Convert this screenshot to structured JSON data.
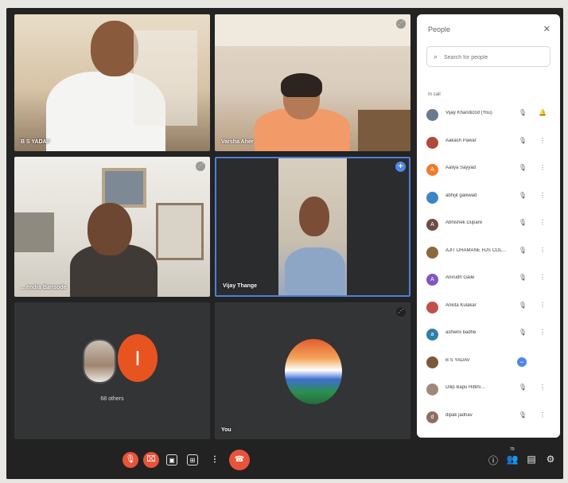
{
  "tiles": {
    "t1": {
      "name": "B S YADAV"
    },
    "t2": {
      "name": "Varsha Aher"
    },
    "t3": {
      "name": "…endra Bansode"
    },
    "t4": {
      "name": "Vijay Thange"
    },
    "t5": {
      "avatar_letter": "I",
      "others": "68 others"
    },
    "t6": {
      "name": "You"
    }
  },
  "panel": {
    "title": "People",
    "close": "✕",
    "search_placeholder": "Search for people",
    "section": "In call",
    "people": [
      {
        "name": "Vijay Khandizod (You)",
        "avatar": "",
        "color": "#6b7a8c",
        "mic": "🎙",
        "more": "🔔"
      },
      {
        "name": "Aakash Pawar",
        "avatar": "",
        "color": "#b04a3a",
        "mic": "🎙",
        "more": "⋮"
      },
      {
        "name": "Aaliya Sayyad",
        "avatar": "A",
        "color": "#f07b2d",
        "mic": "🎙",
        "more": "⋮"
      },
      {
        "name": "abhijit gaikwad",
        "avatar": "",
        "color": "#3d86c6",
        "mic": "🎙",
        "more": "⋮"
      },
      {
        "name": "Abhishek Dupare",
        "avatar": "A",
        "color": "#6d4c41",
        "mic": "🎙",
        "more": "⋮"
      },
      {
        "name": "AJIT DHAMANE HJS COL…",
        "avatar": "",
        "color": "#8a6a3a",
        "mic": "🎙",
        "more": "⋮"
      },
      {
        "name": "Anirudh Gaile",
        "avatar": "A",
        "color": "#7e57c2",
        "mic": "🎙",
        "more": "⋮"
      },
      {
        "name": "Ankita Kulakar",
        "avatar": "",
        "color": "#c0504d",
        "mic": "🎙",
        "more": "⋮"
      },
      {
        "name": "ashwini badhe",
        "avatar": "a",
        "color": "#2e7fa6",
        "mic": "🎙",
        "more": "⋮"
      },
      {
        "name": "B S YADAV",
        "avatar": "",
        "color": "#7a5a3a",
        "mic": "",
        "more": "−"
      },
      {
        "name": "Dilip Bapu Hittihi…",
        "avatar": "",
        "color": "#9e8a78",
        "mic": "🎙",
        "more": "⋮"
      },
      {
        "name": "dipak jadhav",
        "avatar": "d",
        "color": "#8d6e63",
        "mic": "🎙",
        "more": "⋮"
      }
    ]
  },
  "controls": {
    "mic": "🎙",
    "cam": "⌧",
    "captions": "▣",
    "present": "⊞",
    "more": "⋮",
    "hangup": "☎"
  },
  "right_controls": {
    "info": "ⓘ",
    "people": "👥",
    "people_badge": "70",
    "chat": "▤",
    "activities": "⚙"
  }
}
